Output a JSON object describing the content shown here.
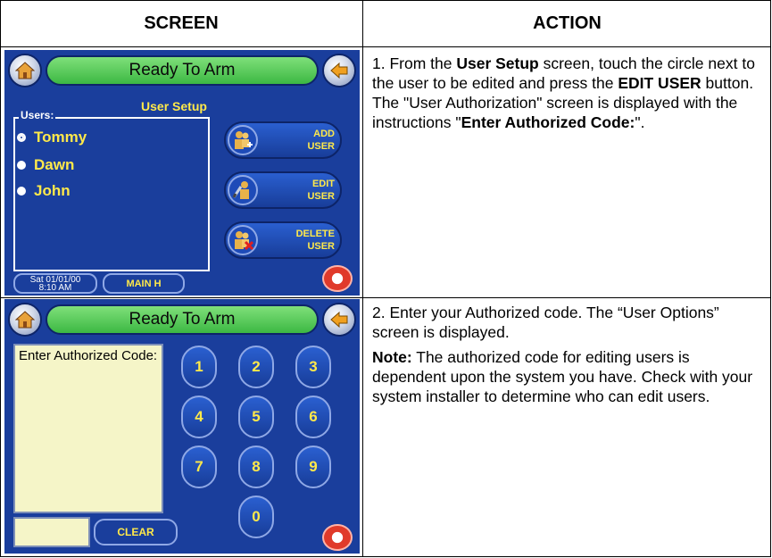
{
  "headers": {
    "screen": "SCREEN",
    "action": "ACTION"
  },
  "screen1": {
    "status": "Ready To Arm",
    "title": "User Setup",
    "users_legend": "Users:",
    "users": [
      "Tommy",
      "Dawn",
      "John"
    ],
    "selected_index": 0,
    "add_btn": [
      "ADD",
      "USER"
    ],
    "edit_btn": [
      "EDIT",
      "USER"
    ],
    "delete_btn": [
      "DELETE",
      "USER"
    ],
    "date": "Sat 01/01/00",
    "time": "8:10 AM",
    "main_btn": "MAIN H"
  },
  "screen2": {
    "status": "Ready To Arm",
    "prompt": "Enter Authorized Code:",
    "keys": [
      "1",
      "2",
      "3",
      "4",
      "5",
      "6",
      "7",
      "8",
      "9",
      "0"
    ],
    "clear_btn": "CLEAR"
  },
  "action1": {
    "t1": "1.  From the ",
    "b1": "User Setup",
    "t2": " screen, touch the circle next to the user to be edited and press the ",
    "b2": "EDIT USER",
    "t3": " button.  The \"User Authorization\" screen is displayed with the instructions \"",
    "b3": "Enter Authorized Code:",
    "t4": "\"."
  },
  "action2": {
    "p1": "2.  Enter your Authorized code.  The “User Options” screen is displayed.",
    "note_label": "Note:",
    "note_text": " The authorized code for editing users is dependent upon the system you have. Check with your system installer to determine who can edit users."
  },
  "colors": {
    "screen_bg": "#1a3e9c",
    "status_green": "#3cb843",
    "label_yellow": "#ffe94a",
    "prompt_bg": "#f5f5c8"
  }
}
